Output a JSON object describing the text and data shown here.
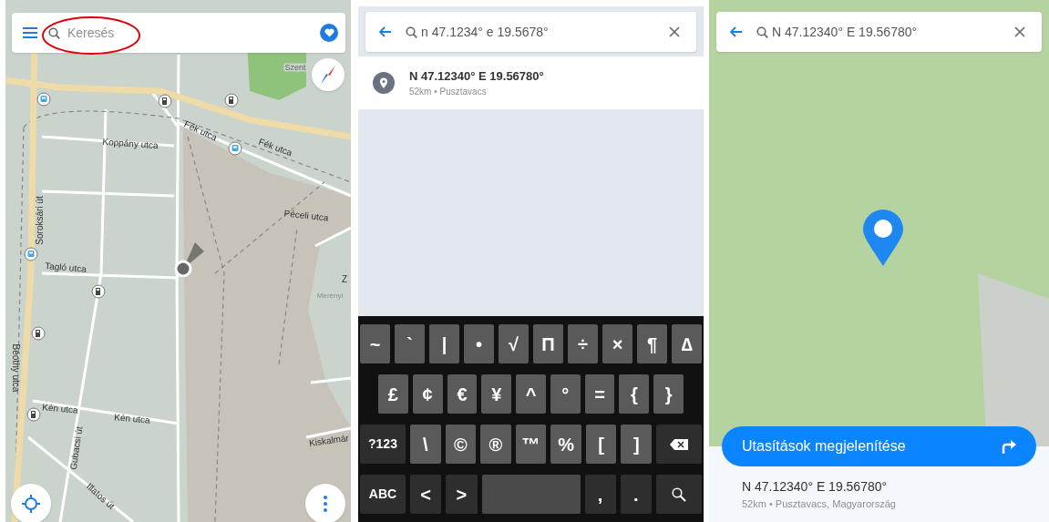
{
  "map_screen": {
    "search": {
      "placeholder": "Keresés"
    },
    "street_labels": [
      {
        "text": "Szent"
      },
      {
        "text": "Koppány utca"
      },
      {
        "text": "Fék utca"
      },
      {
        "text": "Fék utca"
      },
      {
        "text": "Péceli utca"
      },
      {
        "text": "Soroksári út"
      },
      {
        "text": "Tagló utca"
      },
      {
        "text": "Z"
      },
      {
        "text": "Merényi"
      },
      {
        "text": "Béothy utca"
      },
      {
        "text": "Kén utca"
      },
      {
        "text": "Kén utca"
      },
      {
        "text": "Gubacsi út"
      },
      {
        "text": "Illatos út"
      },
      {
        "text": "Kiskalmár"
      }
    ]
  },
  "search_screen": {
    "search": {
      "value": "n 47.1234° e 19.5678°"
    },
    "results": [
      {
        "title": "N 47.12340° E 19.56780°",
        "subtitle": "52km • Pusztavacs"
      }
    ],
    "keyboard": {
      "rows": [
        {
          "keys": [
            {
              "label": "~",
              "kind": "symbol"
            },
            {
              "label": "`",
              "kind": "symbol"
            },
            {
              "label": "|",
              "kind": "symbol"
            },
            {
              "label": "•",
              "kind": "symbol"
            },
            {
              "label": "√",
              "kind": "symbol"
            },
            {
              "label": "Π",
              "kind": "symbol"
            },
            {
              "label": "÷",
              "kind": "symbol"
            },
            {
              "label": "×",
              "kind": "symbol"
            },
            {
              "label": "¶",
              "kind": "symbol"
            },
            {
              "label": "∆",
              "kind": "symbol"
            }
          ]
        },
        {
          "keys": [
            {
              "label": "£",
              "kind": "symbol"
            },
            {
              "label": "¢",
              "kind": "symbol"
            },
            {
              "label": "€",
              "kind": "symbol"
            },
            {
              "label": "¥",
              "kind": "symbol"
            },
            {
              "label": "^",
              "kind": "symbol"
            },
            {
              "label": "°",
              "kind": "symbol"
            },
            {
              "label": "=",
              "kind": "symbol"
            },
            {
              "label": "{",
              "kind": "symbol"
            },
            {
              "label": "}",
              "kind": "symbol"
            }
          ]
        },
        {
          "keys": [
            {
              "label": "?123",
              "kind": "function"
            },
            {
              "label": "\\",
              "kind": "symbol"
            },
            {
              "label": "©",
              "kind": "symbol"
            },
            {
              "label": "®",
              "kind": "symbol"
            },
            {
              "label": "™",
              "kind": "symbol"
            },
            {
              "label": "%",
              "kind": "symbol"
            },
            {
              "label": "[",
              "kind": "symbol"
            },
            {
              "label": "]",
              "kind": "symbol"
            },
            {
              "kind": "backspace"
            }
          ]
        },
        {
          "keys": [
            {
              "label": "ABC",
              "kind": "function"
            },
            {
              "label": "<",
              "kind": "function"
            },
            {
              "label": ">",
              "kind": "function"
            },
            {
              "kind": "space"
            },
            {
              "label": ",",
              "kind": "function"
            },
            {
              "label": ".",
              "kind": "function"
            },
            {
              "kind": "search"
            }
          ]
        }
      ]
    }
  },
  "location_screen": {
    "search": {
      "value": "N 47.12340° E 19.56780°"
    },
    "directions_button": "Utasítások megjelenítése",
    "place": {
      "title": "N 47.12340° E 19.56780°",
      "subtitle": "52km • Pusztavacs, Magyarország"
    }
  }
}
